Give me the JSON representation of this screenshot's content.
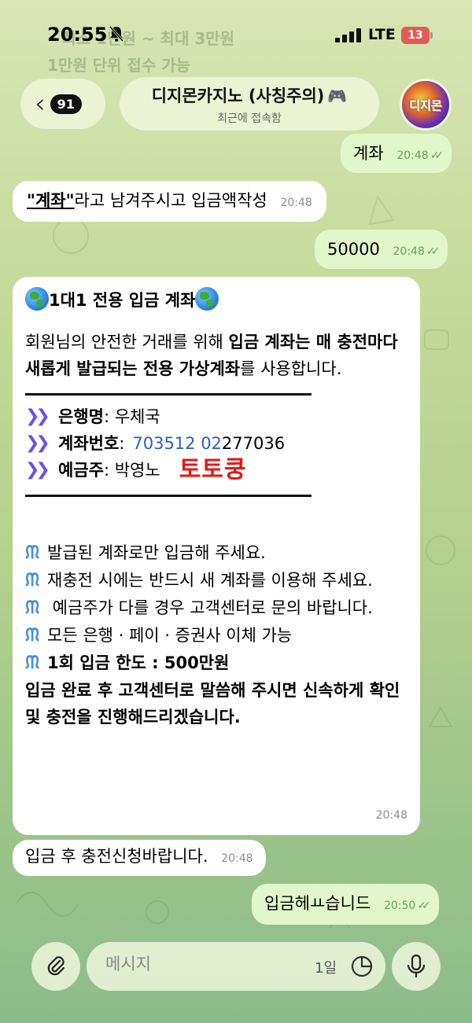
{
  "status_bar": {
    "time": "20:55",
    "network": "LTE",
    "battery": "13"
  },
  "faded_pinned": {
    "line1": "ㆍ최소 1만원 ~ 최대 3만원",
    "line2": "1만원 단위 접수 가능"
  },
  "header": {
    "back_badge": "91",
    "title": "디지몬카지노 (사칭주의)",
    "subtitle": "최근에 접속함",
    "avatar_text": "디지몬"
  },
  "messages": [
    {
      "direction": "out",
      "text": "계좌",
      "time": "20:48"
    },
    {
      "direction": "in",
      "quote": "\"계좌\"",
      "text": "라고 남겨주시고 입금액작성",
      "time": "20:48"
    },
    {
      "direction": "out",
      "text": "50000",
      "time": "20:48"
    },
    {
      "direction": "in",
      "heading": "1대1 전용 입금 계좌",
      "intro_plain": "회원님의 안전한 거래를 위해 ",
      "intro_bold": "입금 계좌는 매 충전마다 새롭게 발급되는 전용 가상계좌",
      "intro_end": "를 사용합니다.",
      "bank_label": "은행명",
      "bank_value": " : 우체국",
      "account_label": "계좌번호",
      "account_sep": " : ",
      "account_link": "703512 02",
      "account_rest": " 277036",
      "holder_label": "예금주",
      "holder_value": " : 박영노",
      "stamp": "토토쿵",
      "notes": [
        "발급된 계좌로만 입금해 주세요.",
        "재충전 시에는 반드시 새 계좌를 이용해 주세요.",
        " 예금주가 다를 경우 고객센터로 문의 바랍니다.",
        "모든 은행 · 페이 · 증권사 이체 가능"
      ],
      "limit": "1회 입금 한도 : 500만원",
      "closing": "입금 완료 후 고객센터로 말씀해 주시면 신속하게 확인 및 충전을 진행해드리겠습니다.",
      "time": "20:48"
    },
    {
      "direction": "in",
      "text": "입금 후 충전신청바랍니다.",
      "time": "20:48"
    },
    {
      "direction": "out",
      "text": "입금헤ㅛ습니드",
      "time": "20:50"
    }
  ],
  "composer": {
    "placeholder": "메시지",
    "counter": "1일"
  }
}
